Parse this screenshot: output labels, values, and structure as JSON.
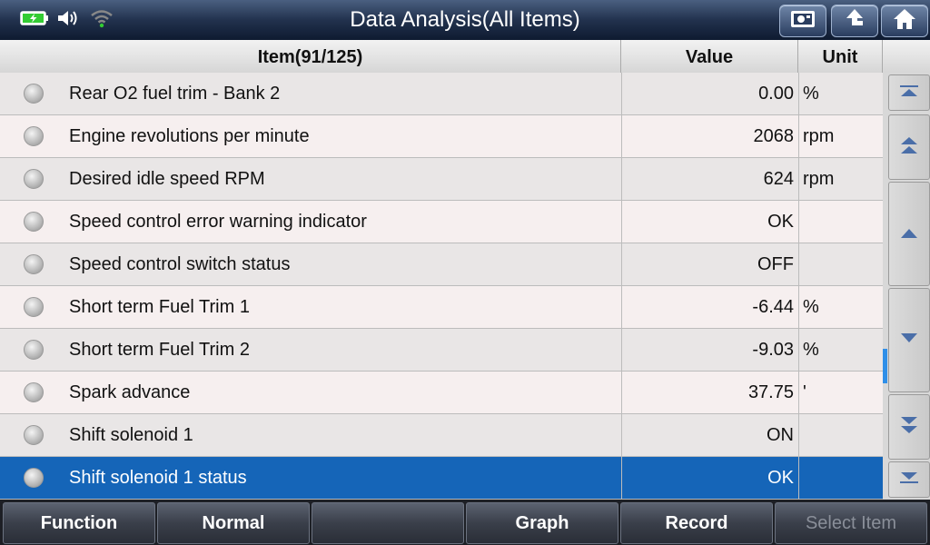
{
  "header": {
    "title": "Data Analysis(All Items)"
  },
  "status_icons": [
    "battery-charging-icon",
    "speaker-icon",
    "wifi-icon"
  ],
  "toolbar_icons": [
    "screenshot-icon",
    "back-arrow-icon",
    "home-icon"
  ],
  "table": {
    "columns": [
      "Item(91/125)",
      "Value",
      "Unit"
    ],
    "rows": [
      {
        "name": "Rear O2 fuel trim - Bank 2",
        "value": "0.00",
        "unit": "%"
      },
      {
        "name": "Engine revolutions per minute",
        "value": "2068",
        "unit": "rpm"
      },
      {
        "name": "Desired idle speed RPM",
        "value": "624",
        "unit": "rpm"
      },
      {
        "name": "Speed control error warning indicator",
        "value": "OK",
        "unit": ""
      },
      {
        "name": "Speed control switch status",
        "value": "OFF",
        "unit": ""
      },
      {
        "name": "Short term Fuel Trim 1",
        "value": "-6.44",
        "unit": "%"
      },
      {
        "name": "Short term Fuel Trim 2",
        "value": "-9.03",
        "unit": "%"
      },
      {
        "name": "Spark advance",
        "value": "37.75",
        "unit": "'"
      },
      {
        "name": "Shift solenoid 1",
        "value": "ON",
        "unit": ""
      },
      {
        "name": "Shift solenoid 1 status",
        "value": "OK",
        "unit": ""
      }
    ],
    "selected_index": 9
  },
  "scroll_buttons": [
    "scroll-top-icon",
    "page-up-icon",
    "line-up-icon",
    "line-down-icon",
    "page-down-icon",
    "scroll-bottom-icon"
  ],
  "footer": {
    "buttons": [
      "Function",
      "Normal",
      "",
      "Graph",
      "Record",
      "Select Item"
    ]
  },
  "colors": {
    "selected_row": "#1565b8",
    "scroll_thumb": "#2f8fe8",
    "battery": "#33cc33"
  }
}
